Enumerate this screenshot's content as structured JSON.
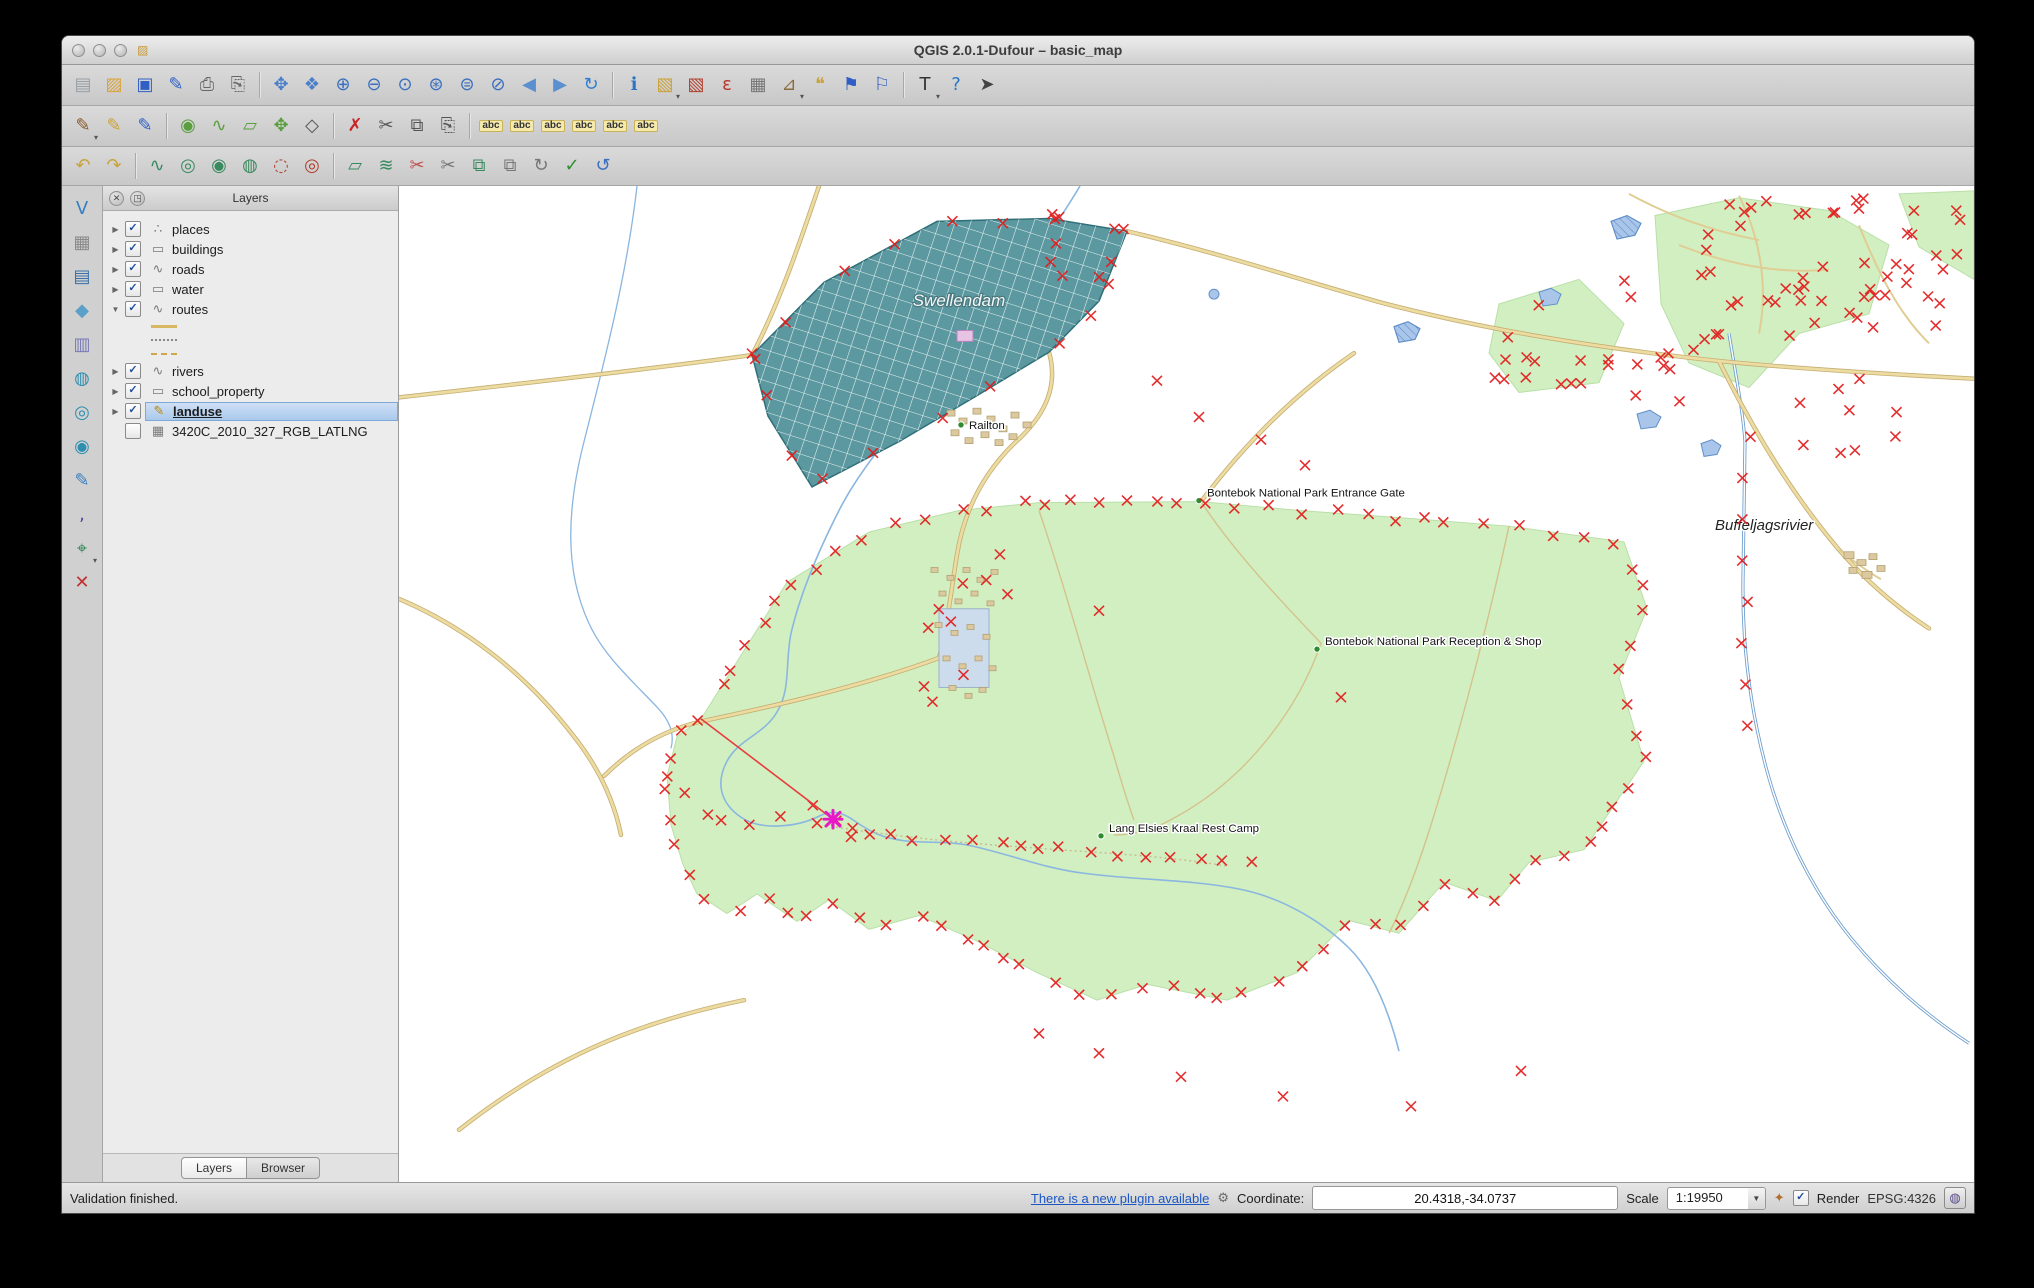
{
  "window": {
    "title": "QGIS 2.0.1-Dufour – basic_map"
  },
  "toolbar_main": {
    "items": [
      {
        "name": "new-project",
        "glyph": "▤",
        "color": "#9aa0a6"
      },
      {
        "name": "open-project",
        "glyph": "▨",
        "color": "#d9a33c"
      },
      {
        "name": "save-project",
        "glyph": "▣",
        "color": "#2f5fc4"
      },
      {
        "name": "save-project-as",
        "glyph": "✎",
        "color": "#2f5fc4"
      },
      {
        "name": "new-print-composer",
        "glyph": "⎙",
        "color": "#666666"
      },
      {
        "name": "composer-manager",
        "glyph": "⎘",
        "color": "#666666"
      },
      {
        "sep": true
      },
      {
        "name": "pan-map",
        "glyph": "✥",
        "color": "#4a7fc9"
      },
      {
        "name": "pan-to-selection",
        "glyph": "❖",
        "color": "#4a7fc9"
      },
      {
        "name": "zoom-in",
        "glyph": "⊕",
        "color": "#3a6fbf"
      },
      {
        "name": "zoom-out",
        "glyph": "⊖",
        "color": "#3a6fbf"
      },
      {
        "name": "zoom-actual-size",
        "glyph": "⊙",
        "color": "#3a6fbf"
      },
      {
        "name": "zoom-full-extent",
        "glyph": "⊛",
        "color": "#3a6fbf"
      },
      {
        "name": "zoom-to-selection",
        "glyph": "⊜",
        "color": "#3a6fbf"
      },
      {
        "name": "zoom-to-layer",
        "glyph": "⊘",
        "color": "#3a6fbf"
      },
      {
        "name": "zoom-last",
        "glyph": "◀",
        "color": "#5a8fd0"
      },
      {
        "name": "zoom-next",
        "glyph": "▶",
        "color": "#5a8fd0"
      },
      {
        "name": "refresh-map",
        "glyph": "↻",
        "color": "#2e7fd4"
      },
      {
        "sep": true
      },
      {
        "name": "identify-features",
        "glyph": "ℹ",
        "color": "#2a76c6"
      },
      {
        "name": "select-features",
        "glyph": "▧",
        "color": "#c9a23a",
        "dd": true
      },
      {
        "name": "deselect-features",
        "glyph": "▧",
        "color": "#b04030"
      },
      {
        "name": "select-by-expression",
        "glyph": "ε",
        "color": "#b8372e"
      },
      {
        "name": "open-attribute-table",
        "glyph": "▦",
        "color": "#777777"
      },
      {
        "name": "measure",
        "glyph": "⊿",
        "color": "#8a6d3b",
        "dd": true
      },
      {
        "name": "map-tips",
        "glyph": "❝",
        "color": "#c9a23a"
      },
      {
        "name": "new-bookmark",
        "glyph": "⚑",
        "color": "#2f5fc4"
      },
      {
        "name": "show-bookmarks",
        "glyph": "⚐",
        "color": "#2f5fc4"
      },
      {
        "sep": true
      },
      {
        "name": "text-annotation",
        "glyph": "T",
        "color": "#333333",
        "dd": true
      },
      {
        "name": "help-contents",
        "glyph": "?",
        "color": "#2a76c6"
      },
      {
        "name": "whats-this",
        "glyph": "➤",
        "color": "#444444"
      }
    ]
  },
  "toolbar_digitizing": {
    "items": [
      {
        "name": "current-edits",
        "glyph": "✎",
        "color": "#8a5a2a",
        "dd": true
      },
      {
        "name": "toggle-editing",
        "glyph": "✎",
        "color": "#c9a23a"
      },
      {
        "name": "save-layer-edits",
        "glyph": "✎",
        "color": "#2f5fc4"
      },
      {
        "sep": true
      },
      {
        "name": "add-feature-point",
        "glyph": "◉",
        "color": "#5a9e3f"
      },
      {
        "name": "add-feature-line",
        "glyph": "∿",
        "color": "#5a9e3f"
      },
      {
        "name": "add-feature-polygon",
        "glyph": "▱",
        "color": "#5a9e3f"
      },
      {
        "name": "move-feature",
        "glyph": "✥",
        "color": "#5a9e3f"
      },
      {
        "name": "node-tool",
        "glyph": "◇",
        "color": "#555555"
      },
      {
        "sep": true
      },
      {
        "name": "delete-selected",
        "glyph": "✗",
        "color": "#cc2222"
      },
      {
        "name": "cut-features",
        "glyph": "✂",
        "color": "#555555"
      },
      {
        "name": "copy-features",
        "glyph": "⧉",
        "color": "#555555"
      },
      {
        "name": "paste-features",
        "glyph": "⎘",
        "color": "#555555"
      },
      {
        "sep": true
      },
      {
        "name": "labeling-options",
        "glyph": "abc",
        "color": "#333333"
      },
      {
        "name": "label-pin-unpin",
        "glyph": "abc",
        "color": "#333333"
      },
      {
        "name": "label-show-hide",
        "glyph": "abc",
        "color": "#333333"
      },
      {
        "name": "label-move",
        "glyph": "abc",
        "color": "#333333"
      },
      {
        "name": "label-rotate",
        "glyph": "abc",
        "color": "#333333"
      },
      {
        "name": "label-properties",
        "glyph": "abc",
        "color": "#333333"
      }
    ]
  },
  "toolbar_advanced": {
    "items": [
      {
        "name": "undo",
        "glyph": "↶",
        "color": "#c9a23a"
      },
      {
        "name": "redo",
        "glyph": "↷",
        "color": "#c9a23a"
      },
      {
        "sep": true
      },
      {
        "name": "simplify-feature",
        "glyph": "∿",
        "color": "#3a8a5f"
      },
      {
        "name": "add-ring",
        "glyph": "◎",
        "color": "#3a8a5f"
      },
      {
        "name": "add-part",
        "glyph": "◉",
        "color": "#3a8a5f"
      },
      {
        "name": "fill-ring",
        "glyph": "◍",
        "color": "#3a8a5f"
      },
      {
        "name": "delete-ring",
        "glyph": "◌",
        "color": "#b04030"
      },
      {
        "name": "delete-part",
        "glyph": "◎",
        "color": "#b04030"
      },
      {
        "sep": true
      },
      {
        "name": "reshape-features",
        "glyph": "▱",
        "color": "#3a8a5f"
      },
      {
        "name": "offset-curve",
        "glyph": "≋",
        "color": "#3a8a5f"
      },
      {
        "name": "split-features",
        "glyph": "✂",
        "color": "#c05050"
      },
      {
        "name": "split-parts",
        "glyph": "✂",
        "color": "#777777"
      },
      {
        "name": "merge-features",
        "glyph": "⧉",
        "color": "#3a8a5f"
      },
      {
        "name": "merge-attributes",
        "glyph": "⧉",
        "color": "#777777"
      },
      {
        "name": "rotate-point-symbols",
        "glyph": "↻",
        "color": "#777777"
      },
      {
        "name": "check-validity",
        "glyph": "✓",
        "color": "#2f8f2f"
      },
      {
        "name": "rollback-edits",
        "glyph": "↺",
        "color": "#3a6fbf"
      }
    ]
  },
  "left_toolbar": {
    "items": [
      {
        "name": "add-vector-layer",
        "glyph": "V",
        "color": "#3a7fbf"
      },
      {
        "name": "add-raster-layer",
        "glyph": "▦",
        "color": "#8a8a8a"
      },
      {
        "name": "add-postgis-layer",
        "glyph": "▤",
        "color": "#3a6fa8"
      },
      {
        "name": "add-spatialite-layer",
        "glyph": "◆",
        "color": "#5aa0c8"
      },
      {
        "name": "add-mssql-layer",
        "glyph": "▥",
        "color": "#7a7ab8"
      },
      {
        "name": "add-wms-layer",
        "glyph": "◍",
        "color": "#2f8fb0"
      },
      {
        "name": "add-wcs-layer",
        "glyph": "◎",
        "color": "#2f8fb0"
      },
      {
        "name": "add-wfs-layer",
        "glyph": "◉",
        "color": "#2f8fb0"
      },
      {
        "name": "new-shapefile-layer",
        "glyph": "✎",
        "color": "#3a7fbf"
      },
      {
        "name": "add-delimited-text-layer",
        "glyph": ",",
        "color": "#4a4a9f"
      },
      {
        "name": "add-gps-layer",
        "glyph": "⌖",
        "color": "#3a8a5f",
        "dd": true
      },
      {
        "name": "remove-layer",
        "glyph": "✕",
        "color": "#c03030"
      }
    ]
  },
  "layers_panel": {
    "title": "Layers",
    "items": [
      {
        "label": "places",
        "arrow": "right",
        "checked": true,
        "icon": "points"
      },
      {
        "label": "buildings",
        "arrow": "right",
        "checked": true,
        "icon": "polygon"
      },
      {
        "label": "roads",
        "arrow": "right",
        "checked": true,
        "icon": "line"
      },
      {
        "label": "water",
        "arrow": "right",
        "checked": true,
        "icon": "polygon"
      },
      {
        "label": "routes",
        "arrow": "down",
        "checked": true,
        "icon": "line",
        "legend": [
          "solid",
          "dotted",
          "dashed"
        ]
      },
      {
        "label": "rivers",
        "arrow": "right",
        "checked": true,
        "icon": "line"
      },
      {
        "label": "school_property",
        "arrow": "right",
        "checked": true,
        "icon": "polygon"
      },
      {
        "label": "landuse",
        "arrow": "right",
        "checked": true,
        "icon": "pencil",
        "selected": true
      },
      {
        "label": "3420C_2010_327_RGB_LATLNG",
        "arrow": "none",
        "checked": false,
        "icon": "raster"
      }
    ],
    "tabs": [
      {
        "label": "Layers",
        "active": true
      },
      {
        "label": "Browser",
        "active": false
      }
    ]
  },
  "map": {
    "labels": {
      "swellendam": "Swellendam",
      "railton": "Railton",
      "entrance_gate": "Bontebok National Park Entrance Gate",
      "reception": "Bontebok National Park Reception & Shop",
      "rest_camp": "Lang Elsies Kraal Rest Camp",
      "buffeljagsrivier": "Buffeljagsrivier"
    },
    "colors": {
      "park_green": "#d2efc2",
      "urban_teal": "#5b98a0",
      "road_tan": "#ecdca2",
      "river_blue": "#8ab6e0",
      "vertex_red": "#e21b1b",
      "rubber_magenta": "#e818c8"
    }
  },
  "status_bar": {
    "message": "Validation finished.",
    "plugin_link": "There is a new plugin available",
    "coordinate_label": "Coordinate:",
    "coordinate_value": "20.4318,-34.0737",
    "scale_label": "Scale",
    "scale_value": "1:19950",
    "render_label": "Render",
    "crs": "EPSG:4326"
  }
}
